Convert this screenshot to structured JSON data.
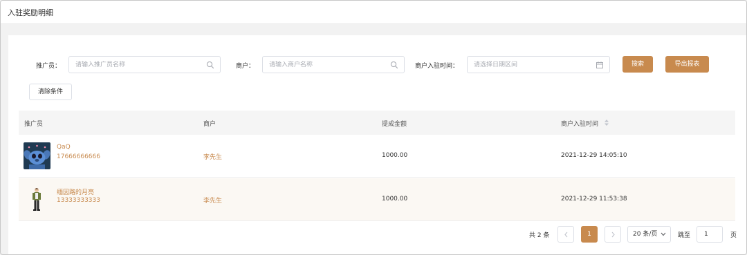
{
  "page": {
    "title": "入驻奖励明细"
  },
  "filters": {
    "promoter_label": "推广员：",
    "promoter_placeholder": "请输入推广员名称",
    "merchant_label": "商户：",
    "merchant_placeholder": "请输入商户名称",
    "date_label": "商户入驻时间：",
    "date_placeholder": "请选择日期区间",
    "search_button": "搜索",
    "export_button": "导出报表",
    "clear_button": "清除条件"
  },
  "table": {
    "columns": [
      "推广员",
      "商户",
      "提成金额",
      "商户入驻时间"
    ],
    "rows": [
      {
        "promoter_name": "QaQ",
        "promoter_phone": "17666666666",
        "avatar_icon": "blue-creature-avatar",
        "merchant": "李先生",
        "amount": "1000.00",
        "join_time": "2021-12-29 14:05:10"
      },
      {
        "promoter_name": "缅因路的月亮",
        "promoter_phone": "13333333333",
        "avatar_icon": "standing-person-avatar",
        "merchant": "李先生",
        "amount": "1000.00",
        "join_time": "2021-12-29 11:53:38"
      }
    ]
  },
  "pagination": {
    "total_text": "共 2 条",
    "current_page": "1",
    "page_size": "20 条/页",
    "jump_label": "跳至",
    "jump_value": "1",
    "page_unit": "页"
  },
  "colors": {
    "accent": "#c88a4e",
    "header_bg": "#f5f5f5",
    "alt_row": "#fbf8f3"
  }
}
